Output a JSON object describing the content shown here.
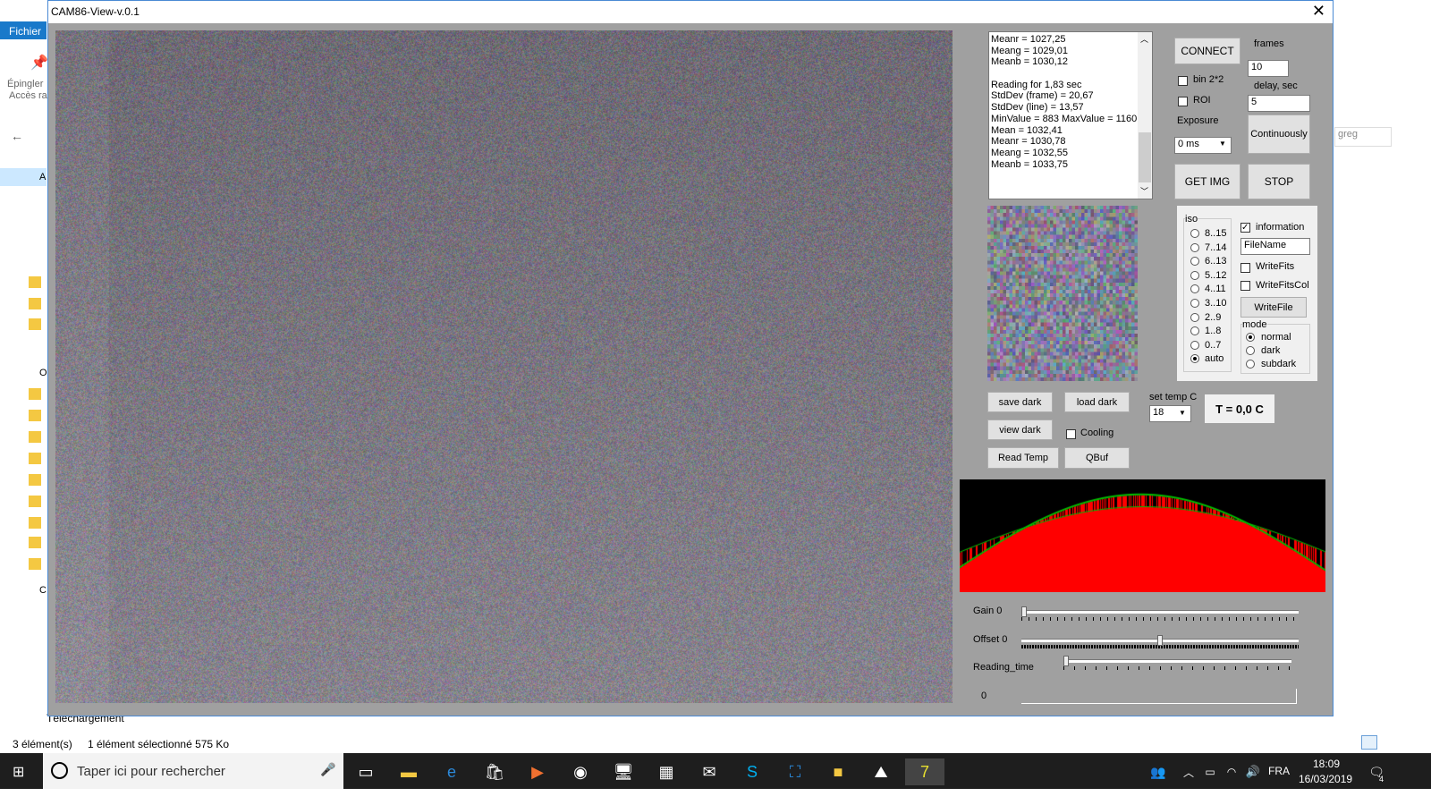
{
  "explorer": {
    "menu_label": "Fichier",
    "pin_label": "Épingler",
    "access_label": "Accès ra",
    "search_placeholder": "greg",
    "status_count": "3 élément(s)",
    "status_selected": "1 élément sélectionné  575 Ko",
    "nav_partial": "Téléchargement",
    "side_letters": [
      "A",
      "O",
      "C"
    ]
  },
  "window": {
    "title": "CAM86-View-v.0.1",
    "close_icon": "close-icon"
  },
  "log": {
    "lines": [
      "Meanr = 1027,25",
      "Meang = 1029,01",
      "Meanb = 1030,12",
      "",
      "Reading for 1,83 sec",
      "StdDev (frame) = 20,67",
      "StdDev (line) = 13,57",
      "MinValue = 883 MaxValue = 1160",
      "Mean = 1032,41",
      "Meanr = 1030,78",
      "Meang = 1032,55",
      "Meanb = 1033,75"
    ]
  },
  "controls": {
    "connect": "CONNECT",
    "frames_label": "frames",
    "frames_value": "10",
    "bin_label": "bin 2*2",
    "roi_label": "ROI",
    "delay_label": "delay, sec",
    "delay_value": "5",
    "exposure_label": "Exposure",
    "exposure_value": "0 ms",
    "continuously": "Continuously",
    "get_img": "GET IMG",
    "stop": "STOP"
  },
  "iso": {
    "label": "iso",
    "options": [
      "8..15",
      "7..14",
      "6..13",
      "5..12",
      "4..11",
      "3..10",
      "2..9",
      "1..8",
      "0..7",
      "auto"
    ],
    "selected": "auto"
  },
  "options": {
    "information_label": "information",
    "information_checked": true,
    "filename_value": "FileName",
    "writefits_label": "WriteFits",
    "writefitscol_label": "WriteFitsCol",
    "writefile": "WriteFile",
    "mode_label": "mode",
    "modes": [
      "normal",
      "dark",
      "subdark"
    ],
    "mode_selected": "normal"
  },
  "dark": {
    "save_dark": "save dark",
    "load_dark": "load dark",
    "view_dark": "view dark",
    "cooling_label": "Cooling",
    "read_temp": "Read Temp",
    "qbuf": "QBuf",
    "set_temp_label": "set temp C",
    "set_temp_value": "18",
    "temp_display": "T = 0,0 C"
  },
  "sliders": {
    "gain_label": "Gain 0",
    "gain_value": 0,
    "offset_label": "Offset 0",
    "offset_value": 0.5,
    "reading_label": "Reading_time",
    "reading_value": 0,
    "progress_label": "0"
  },
  "taskbar": {
    "search_placeholder": "Taper ici pour rechercher",
    "lang": "FRA",
    "time": "18:09",
    "date": "16/03/2019",
    "notif_count": "4"
  },
  "colors": {
    "app_bg": "#a0a0a0",
    "hist_red": "#ff0000",
    "hist_green": "#00c000",
    "taskbar": "#1e1e1e"
  }
}
